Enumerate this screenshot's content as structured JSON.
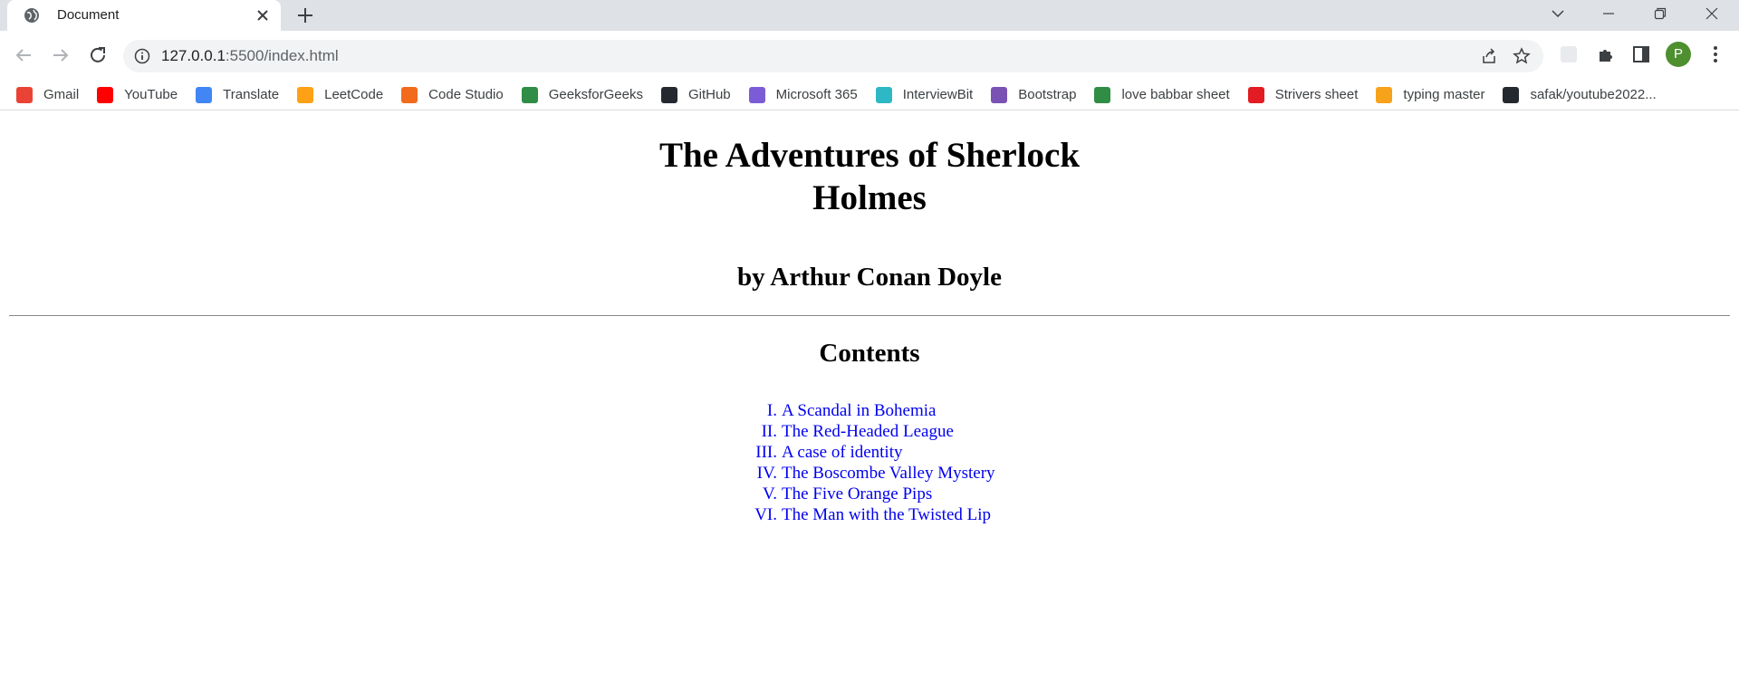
{
  "browser": {
    "tab": {
      "title": "Document"
    },
    "address": {
      "host": "127.0.0.1",
      "path": ":5500/index.html"
    },
    "profile_initial": "P",
    "bookmarks": [
      {
        "label": "Gmail",
        "icon": "gmail-icon",
        "color": "#ea4335"
      },
      {
        "label": "YouTube",
        "icon": "youtube-icon",
        "color": "#ff0000"
      },
      {
        "label": "Translate",
        "icon": "translate-icon",
        "color": "#4285f4"
      },
      {
        "label": "LeetCode",
        "icon": "leetcode-icon",
        "color": "#ffa116"
      },
      {
        "label": "Code Studio",
        "icon": "codestudio-icon",
        "color": "#f26b1d"
      },
      {
        "label": "GeeksforGeeks",
        "icon": "geeksforgeeks-icon",
        "color": "#2f8d46"
      },
      {
        "label": "GitHub",
        "icon": "github-icon",
        "color": "#24292f"
      },
      {
        "label": "Microsoft 365",
        "icon": "microsoft365-icon",
        "color": "#7b5cd6"
      },
      {
        "label": "InterviewBit",
        "icon": "interviewbit-icon",
        "color": "#2eb8c6"
      },
      {
        "label": "Bootstrap",
        "icon": "bootstrap-icon",
        "color": "#7952b3"
      },
      {
        "label": "love babbar sheet",
        "icon": "geeksforgeeks-icon",
        "color": "#2f8d46"
      },
      {
        "label": "Strivers sheet",
        "icon": "tuf-icon",
        "color": "#e31b23"
      },
      {
        "label": "typing master",
        "icon": "typingmaster-icon",
        "color": "#f7a21b"
      },
      {
        "label": "safak/youtube2022...",
        "icon": "github-icon",
        "color": "#24292f"
      }
    ]
  },
  "page": {
    "title": "The Adventures of Sherlock Holmes",
    "author": "by Arthur Conan Doyle",
    "contents_heading": "Contents",
    "chapters": [
      {
        "num": "I.",
        "title": "A Scandal in Bohemia"
      },
      {
        "num": "II.",
        "title": "The Red-Headed League"
      },
      {
        "num": "III.",
        "title": "A case of identity"
      },
      {
        "num": "IV.",
        "title": "The Boscombe Valley Mystery"
      },
      {
        "num": "V.",
        "title": "The Five Orange Pips"
      },
      {
        "num": "VI.",
        "title": "The Man with the Twisted Lip"
      }
    ]
  }
}
